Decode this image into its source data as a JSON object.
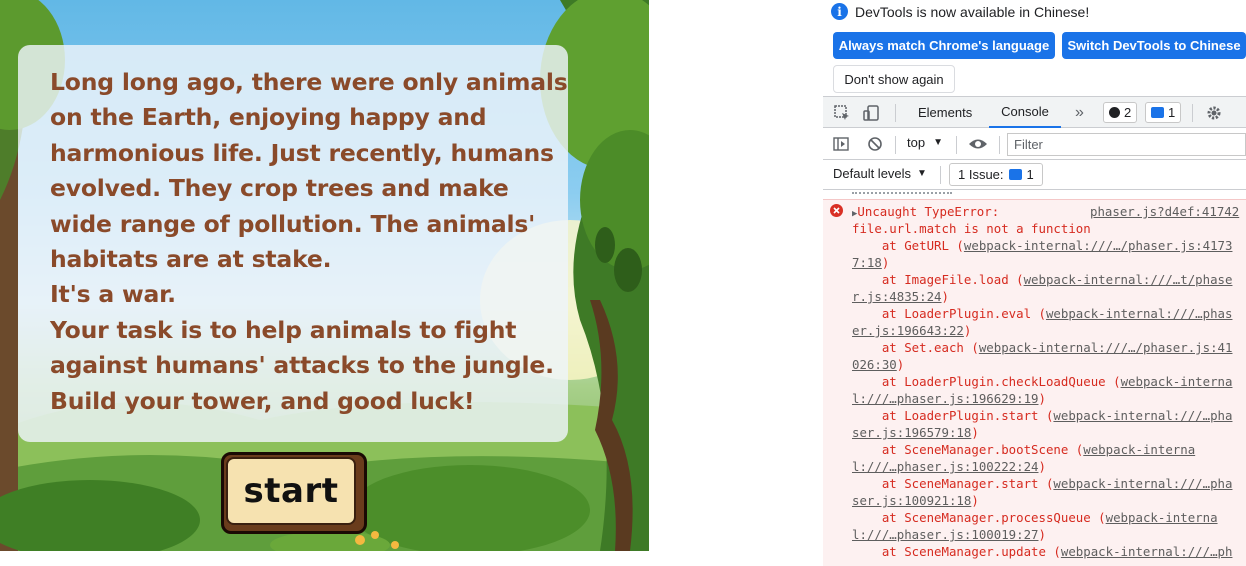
{
  "game": {
    "story_lines": [
      "Long long ago, there were only animals",
      "on the Earth, enjoying happy and",
      "harmonious life. Just recently, humans",
      "evolved. They crop trees and make",
      "wide range of pollution. The animals'",
      "habitats are at stake.",
      "It's a war.",
      "Your task is to help animals to fight",
      "against humans' attacks to the jungle.",
      "Build your tower, and good luck!"
    ],
    "start_label": "start",
    "colors": {
      "text": "#8a4a2a",
      "button_face": "#f6e2b0"
    }
  },
  "devtools": {
    "notice": "DevTools is now available in Chinese!",
    "btn_match_language": "Always match Chrome's language",
    "btn_switch_chinese": "Switch DevTools to Chinese",
    "btn_dont_show": "Don't show again",
    "tabs": {
      "elements": "Elements",
      "console": "Console",
      "more": "»"
    },
    "badges": {
      "errors": "2",
      "messages": "1"
    },
    "toolbar": {
      "context": "top",
      "filter_placeholder": "Filter",
      "levels": "Default levels",
      "issues_label": "1 Issue:",
      "issues_count": "1"
    },
    "error": {
      "message": "Uncaught TypeError:",
      "source_link": "phaser.js?d4ef:41742",
      "detail": "file.url.match is not a function",
      "stack": [
        {
          "at": "at GetURL (",
          "link": "webpack-internal:///…/phaser.js:4173",
          "cont": "7:18)"
        },
        {
          "at": "at ImageFile.load (",
          "link": "webpack-internal:///…t/phase",
          "cont": "r.js:4835:24)"
        },
        {
          "at": "at LoaderPlugin.eval (",
          "link": "webpack-internal:///…phas",
          "cont": "er.js:196643:22)"
        },
        {
          "at": "at Set.each (",
          "link": "webpack-internal:///…/phaser.js:41",
          "cont": "026:30)"
        },
        {
          "at": "at LoaderPlugin.checkLoadQueue (",
          "link": "webpack-interna",
          "cont": "l:///…phaser.js:196629:19)"
        },
        {
          "at": "at LoaderPlugin.start (",
          "link": "webpack-internal:///…pha",
          "cont": "ser.js:196579:18)"
        },
        {
          "at": "at SceneManager.bootScene (",
          "link": "webpack-interna",
          "cont": "l:///…phaser.js:100222:24)"
        },
        {
          "at": "at SceneManager.start (",
          "link": "webpack-internal:///…pha",
          "cont": "ser.js:100921:18)"
        },
        {
          "at": "at SceneManager.processQueue (",
          "link": "webpack-interna",
          "cont": "l:///…phaser.js:100019:27)"
        },
        {
          "at": "at SceneManager.update (",
          "link": "webpack-internal:///…ph",
          "cont": ""
        }
      ]
    }
  }
}
